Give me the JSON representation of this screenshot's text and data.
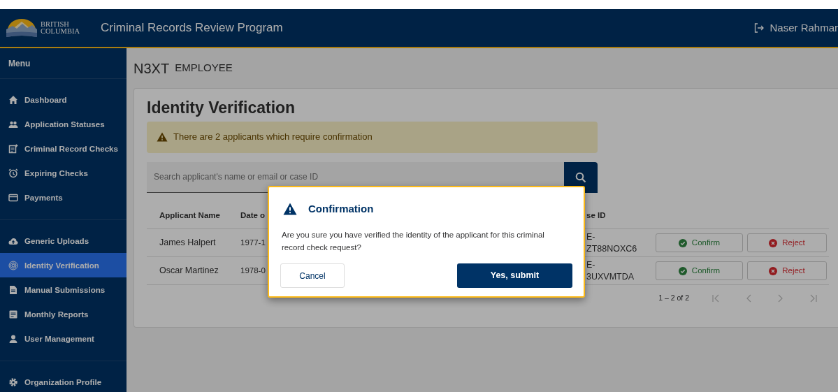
{
  "header": {
    "logo_lines": [
      "BRITISH",
      "COLUMBIA"
    ],
    "title": "Criminal Records Review Program",
    "user": "Naser Rahmar"
  },
  "sidebar": {
    "heading": "Menu",
    "groups": [
      [
        {
          "label": "Dashboard",
          "selected": false
        },
        {
          "label": "Application Statuses",
          "selected": false
        },
        {
          "label": "Criminal Record Checks",
          "selected": false
        },
        {
          "label": "Expiring Checks",
          "selected": false
        },
        {
          "label": "Payments",
          "selected": false
        }
      ],
      [
        {
          "label": "Generic Uploads",
          "selected": false
        },
        {
          "label": "Identity Verification",
          "selected": true
        },
        {
          "label": "Manual Submissions",
          "selected": false
        },
        {
          "label": "Monthly Reports",
          "selected": false
        },
        {
          "label": "User Management",
          "selected": false
        }
      ],
      [
        {
          "label": "Organization Profile",
          "selected": false
        }
      ]
    ]
  },
  "organization": {
    "name": "N3XT",
    "role": "EMPLOYEE"
  },
  "page": {
    "title": "Identity Verification",
    "alert": "There are 2 applicants which require confirmation",
    "search": {
      "placeholder": "Search applicant's name or email or case ID"
    },
    "table": {
      "columns": [
        "Applicant Name",
        "Date o",
        "se ID"
      ],
      "rows": [
        {
          "cells": [
            "James Halpert",
            "1977-1",
            "E-\nZT88NOXC6"
          ],
          "actions": [
            "Confirm",
            "Reject"
          ]
        },
        {
          "cells": [
            "Oscar Martinez",
            "1978-0",
            "E-\n3UXVMTDA"
          ],
          "actions": [
            "Confirm",
            "Reject"
          ]
        }
      ]
    },
    "pagination": {
      "range": "1 – 2 of 2",
      "first_disabled": true,
      "previous_disabled": true,
      "next_disabled": true,
      "last_disabled": true
    }
  },
  "dialog": {
    "title": "Confirmation",
    "message": "Are you sure you have verified the identity of the applicant for this criminal record check request?",
    "buttons": [
      {
        "label": "Cancel",
        "kind": "secondary"
      },
      {
        "label": "Yes, submit",
        "kind": "primary"
      }
    ]
  }
}
